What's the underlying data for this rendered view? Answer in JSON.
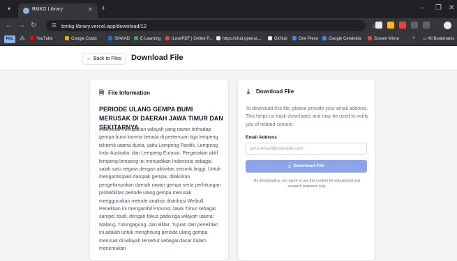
{
  "browser": {
    "tab_title": "BMKG Library",
    "url": "bmkg-library.vercel.app/download/12",
    "profile_badge": "PKL",
    "bookmarks": [
      {
        "label": "YouTube",
        "color": "#ff0000"
      },
      {
        "label": "Google Colab",
        "color": "#f9ab00"
      },
      {
        "label": "SIAKAD",
        "color": "#1a73e8"
      },
      {
        "label": "E-Learning",
        "color": "#34a853"
      },
      {
        "label": "iLovePDF | Online P...",
        "color": "#e8453c"
      },
      {
        "label": "https://chat.openai....",
        "color": "#e8eaed"
      },
      {
        "label": "GitHub",
        "color": "#e8eaed"
      },
      {
        "label": "One Piece",
        "color": "#4285f4"
      },
      {
        "label": "Google Cendekia",
        "color": "#4285f4"
      },
      {
        "label": "Screen Mirror",
        "color": "#e8453c"
      }
    ],
    "all_bookmarks": "All Bookmarks"
  },
  "header": {
    "back_label": "Back to Files",
    "title": "Download File"
  },
  "info_card": {
    "heading": "File Information",
    "paper_title": "PERIODE ULANG GEMPA BUMI MERUSAK DI DAERAH JAWA TIMUR DAN SEKITARNYA",
    "abstract": "Indonesia merupakan wilayah yang rawan terhadap gempa bumi karena berada di pertemuan tiga lempeng tektonik utama dunia, yaitu Lempeng Pasifik, Lempeng Indo-Australia, dan Lempeng Eurasia. Pergerakan aktif lempeng-lempeng ini menjadikan Indonesia sebagai salah satu negara dengan aktivitas seismik tinggi. Untuk mengantisipasi dampak gempa, dilakukan pengelompokan daerah rawan gempa serta perhitungan probabilitas periode ulang gempa merusak menggunakan metode analisis distribusi Weibull. Penelitian ini mengambil Provinsi Jawa Timur sebagai sampel studi, dengan fokus pada tiga wilayah utama: Malang, Tulungagung, dan Blitar. Tujuan dari penelitian ini adalah untuk menghitung periode ulang gempa merusak di wilayah tersebut sebagai dasar dalam menentukan"
  },
  "download_card": {
    "heading": "Download File",
    "description": "To download this file, please provide your email address. This helps us track downloads and may be used to notify you of related content.",
    "email_label": "Email Address",
    "email_placeholder": "your-email@example.com",
    "email_value": "",
    "button_label": "Download File",
    "note": "By downloading, you agree to use this content for educational and research purposes only."
  },
  "colors": {
    "accent_button": "#8ca5ea",
    "page_bg": "#f3f4f6",
    "chrome_dark": "#202124"
  }
}
